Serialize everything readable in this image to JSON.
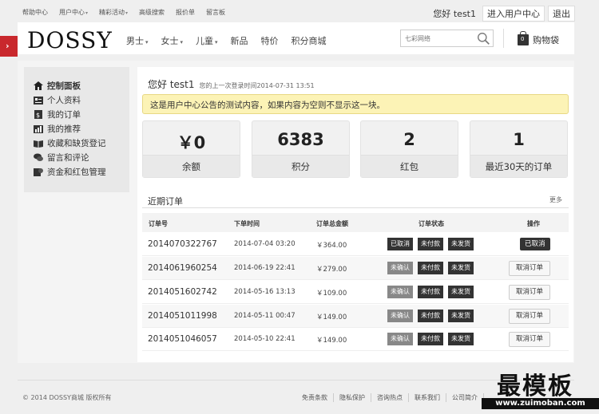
{
  "topnav": {
    "items": [
      {
        "label": "帮助中心"
      },
      {
        "label": "用户中心"
      },
      {
        "label": "精彩活动"
      },
      {
        "label": "高级搜索"
      },
      {
        "label": "报价单"
      },
      {
        "label": "留言板"
      }
    ],
    "greeting": "您好 test1",
    "enter_center": "进入用户中心",
    "logout": "退出"
  },
  "header": {
    "logo": "DOSSY",
    "nav": [
      {
        "label": "男士"
      },
      {
        "label": "女士"
      },
      {
        "label": "儿童"
      },
      {
        "label": "新品"
      },
      {
        "label": "特价"
      },
      {
        "label": "积分商城"
      }
    ],
    "search_placeholder": "七彩网络",
    "cart": "购物袋",
    "cart_count": "0"
  },
  "sidebar": {
    "items": [
      {
        "label": "控制面板",
        "icon": "home-icon"
      },
      {
        "label": "个人资料",
        "icon": "id-card-icon"
      },
      {
        "label": "我的订单",
        "icon": "order-icon"
      },
      {
        "label": "我的推荐",
        "icon": "chart-icon"
      },
      {
        "label": "收藏和缺货登记",
        "icon": "book-icon"
      },
      {
        "label": "留言和评论",
        "icon": "comment-icon"
      },
      {
        "label": "资金和红包管理",
        "icon": "wallet-icon"
      }
    ]
  },
  "main": {
    "greeting": "您好 test1",
    "last_login": "您的上一次登录时间2014-07-31 13:51",
    "notice": "这是用户中心公告的测试内容，如果内容为空则不显示这一块。",
    "stats": [
      {
        "value": "￥0",
        "label": "余额"
      },
      {
        "value": "6383",
        "label": "积分"
      },
      {
        "value": "2",
        "label": "红包"
      },
      {
        "value": "1",
        "label": "最近30天的订单"
      }
    ],
    "recent_title": "近期订单",
    "more": "更多",
    "table": {
      "headers": [
        "订单号",
        "下单时间",
        "订单总金额",
        "订单状态",
        "操作"
      ],
      "rows": [
        {
          "no": "2014070322767",
          "time": "2014-07-04 03:20",
          "amount": "￥364.00",
          "s1": "已取消",
          "s2": "未付款",
          "s3": "未发货",
          "op": "已取消"
        },
        {
          "no": "2014061960254",
          "time": "2014-06-19 22:41",
          "amount": "￥279.00",
          "s1": "未确认",
          "s2": "未付款",
          "s3": "未发货",
          "op": "取消订单"
        },
        {
          "no": "2014051602742",
          "time": "2014-05-16 13:13",
          "amount": "￥109.00",
          "s1": "未确认",
          "s2": "未付款",
          "s3": "未发货",
          "op": "取消订单"
        },
        {
          "no": "2014051011998",
          "time": "2014-05-11 00:47",
          "amount": "￥149.00",
          "s1": "未确认",
          "s2": "未付款",
          "s3": "未发货",
          "op": "取消订单"
        },
        {
          "no": "2014051046057",
          "time": "2014-05-10 22:41",
          "amount": "￥149.00",
          "s1": "未确认",
          "s2": "未付款",
          "s3": "未发货",
          "op": "取消订单"
        }
      ]
    }
  },
  "footer": {
    "copyright": "© 2014 DOSSY商城 版权所有",
    "links": [
      {
        "label": "免责条款"
      },
      {
        "label": "隐私保护"
      },
      {
        "label": "咨询热点"
      },
      {
        "label": "联系我们"
      },
      {
        "label": "公司简介"
      }
    ],
    "watermark_big": "最模板",
    "watermark_small": "www.zuimoban.com"
  },
  "colors": {
    "accent_red": "#c9282d",
    "notice_bg": "#fcf3b6",
    "tag_dark": "#333333",
    "tag_light": "#888888"
  }
}
